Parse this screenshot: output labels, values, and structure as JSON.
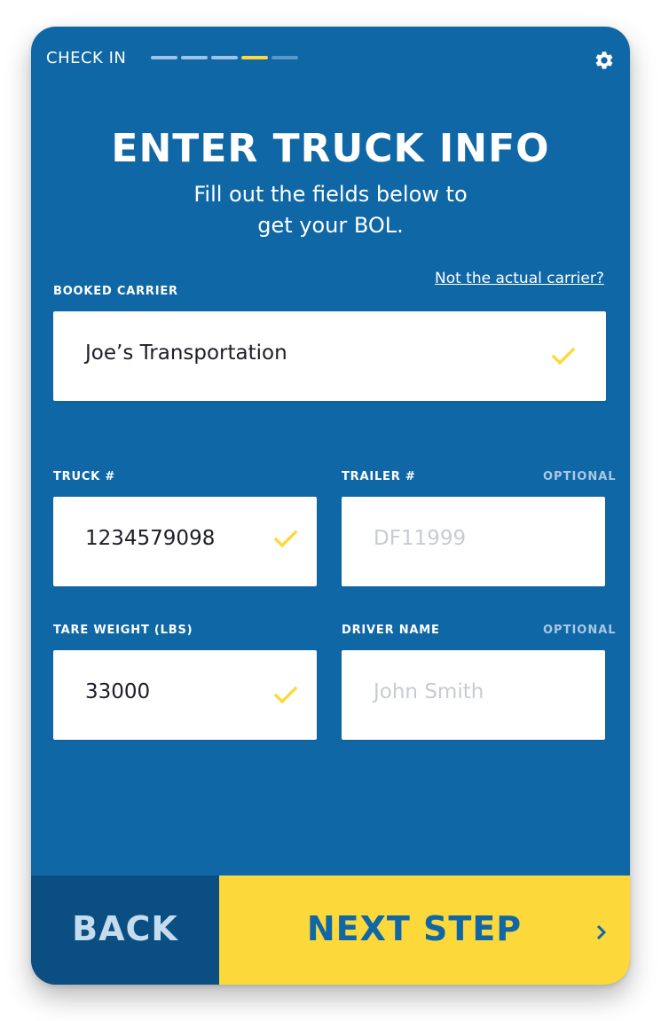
{
  "header": {
    "title": "CHECK IN",
    "progress": {
      "total_steps": 5,
      "current_step": 4
    }
  },
  "page": {
    "title": "ENTER TRUCK INFO",
    "subtitle_line1": "Fill out the fields below to",
    "subtitle_line2": "get your BOL."
  },
  "carrier": {
    "label": "BOOKED CARRIER",
    "link": "Not the actual carrier?",
    "value": "Joe’s Transportation"
  },
  "truck": {
    "label": "TRUCK #",
    "value": "1234579098"
  },
  "trailer": {
    "label": "TRAILER #",
    "optional": "OPTIONAL",
    "placeholder": "DF11999"
  },
  "tare": {
    "label": "TARE WEIGHT (LBS)",
    "value": "33000"
  },
  "driver": {
    "label": "DRIVER NAME",
    "optional": "OPTIONAL",
    "placeholder": "John Smith"
  },
  "footer": {
    "back_label": "BACK",
    "next_label": "NEXT STEP"
  },
  "icons": {
    "settings": "gear-icon",
    "check": "checkmark-icon",
    "next": "chevron-right-icon"
  },
  "colors": {
    "background": "#0f67a6",
    "accent": "#fdd83a",
    "back_button": "#0a4e82",
    "progress_done": "#9ec3e6",
    "progress_current": "#fdd83a",
    "progress_pending": "#5d97c9"
  }
}
